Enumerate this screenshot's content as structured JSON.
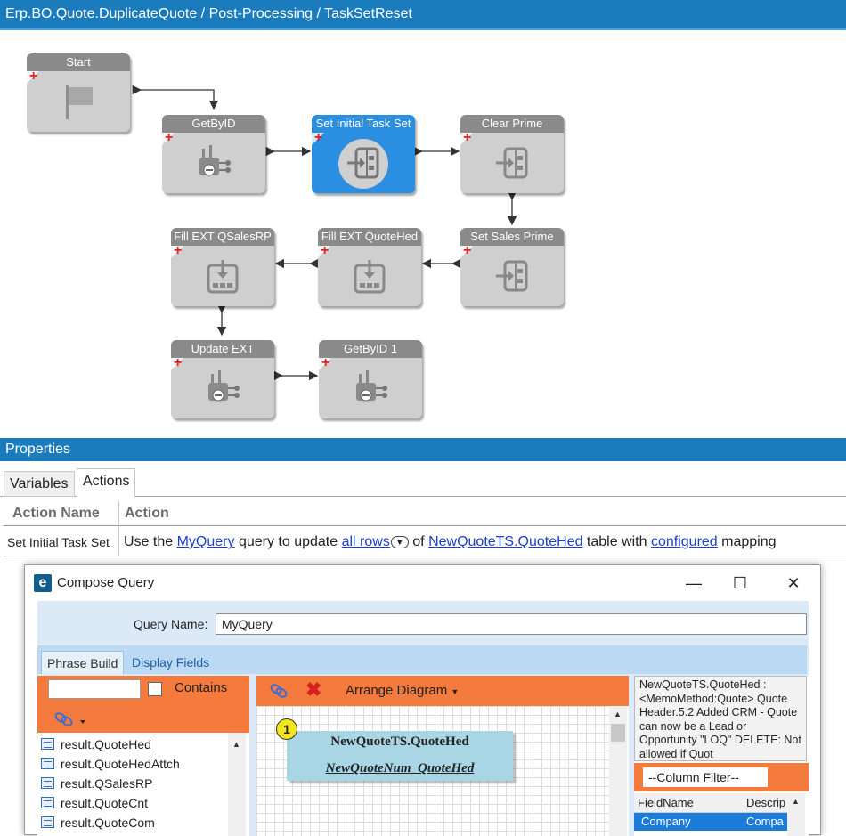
{
  "window": {
    "title": "Erp.BO.Quote.DuplicateQuote / Post-Processing / TaskSetReset"
  },
  "workflow": {
    "nodes": [
      {
        "id": "start",
        "label": "Start",
        "icon": "flag-icon"
      },
      {
        "id": "getbyid",
        "label": "GetByID",
        "icon": "method-call-icon"
      },
      {
        "id": "set-initial",
        "label": "Set Initial Task Set",
        "icon": "set-field-icon",
        "selected": true
      },
      {
        "id": "clear-prime",
        "label": "Clear Prime",
        "icon": "set-field-icon"
      },
      {
        "id": "set-sales-prime",
        "label": "Set Sales Prime",
        "icon": "set-field-icon"
      },
      {
        "id": "fill-quotehed",
        "label": "Fill EXT QuoteHed",
        "icon": "fill-table-icon"
      },
      {
        "id": "fill-qsalesrp",
        "label": "Fill EXT QSalesRP",
        "icon": "fill-table-icon"
      },
      {
        "id": "update-ext",
        "label": "Update EXT",
        "icon": "method-call-icon"
      },
      {
        "id": "getbyid-1",
        "label": "GetByID 1",
        "icon": "method-call-icon"
      }
    ]
  },
  "properties": {
    "title": "Properties",
    "tabs": [
      "Variables",
      "Actions"
    ],
    "active_tab": "Actions",
    "columns": [
      "Action Name",
      "Action"
    ],
    "row": {
      "name": "Set Initial Task Set",
      "t1": "Use the ",
      "query": "MyQuery",
      "t2": " query to update ",
      "rows": "all rows",
      "t3": " of ",
      "table": "NewQuoteTS.QuoteHed",
      "t4": " table with ",
      "configured": "configured",
      "t5": " mapping"
    }
  },
  "dialog": {
    "title": "Compose Query",
    "query_name_label": "Query Name:",
    "query_name": "MyQuery",
    "tabs": [
      "Phrase Build",
      "Display Fields"
    ],
    "contains_label": "Contains",
    "tree_items": [
      "result.QuoteHed",
      "result.QuoteHedAttch",
      "result.QSalesRP",
      "result.QuoteCnt",
      "result.QuoteCom"
    ],
    "arrange_label": "Arrange Diagram",
    "table_box": {
      "number": "1",
      "title": "NewQuoteTS.QuoteHed",
      "alias": "NewQuoteNum_QuoteHed"
    },
    "description": "NewQuoteTS.QuoteHed : <MemoMethod:Quote> Quote Header.5.2 Added CRM - Quote can now be a Lead or Opportunity \"LOQ\" DELETE: Not allowed if Quot",
    "column_filter": "--Column Filter--",
    "field_columns": [
      "FieldName",
      "Descrip"
    ],
    "field_row": [
      "Company",
      "Compa"
    ]
  }
}
